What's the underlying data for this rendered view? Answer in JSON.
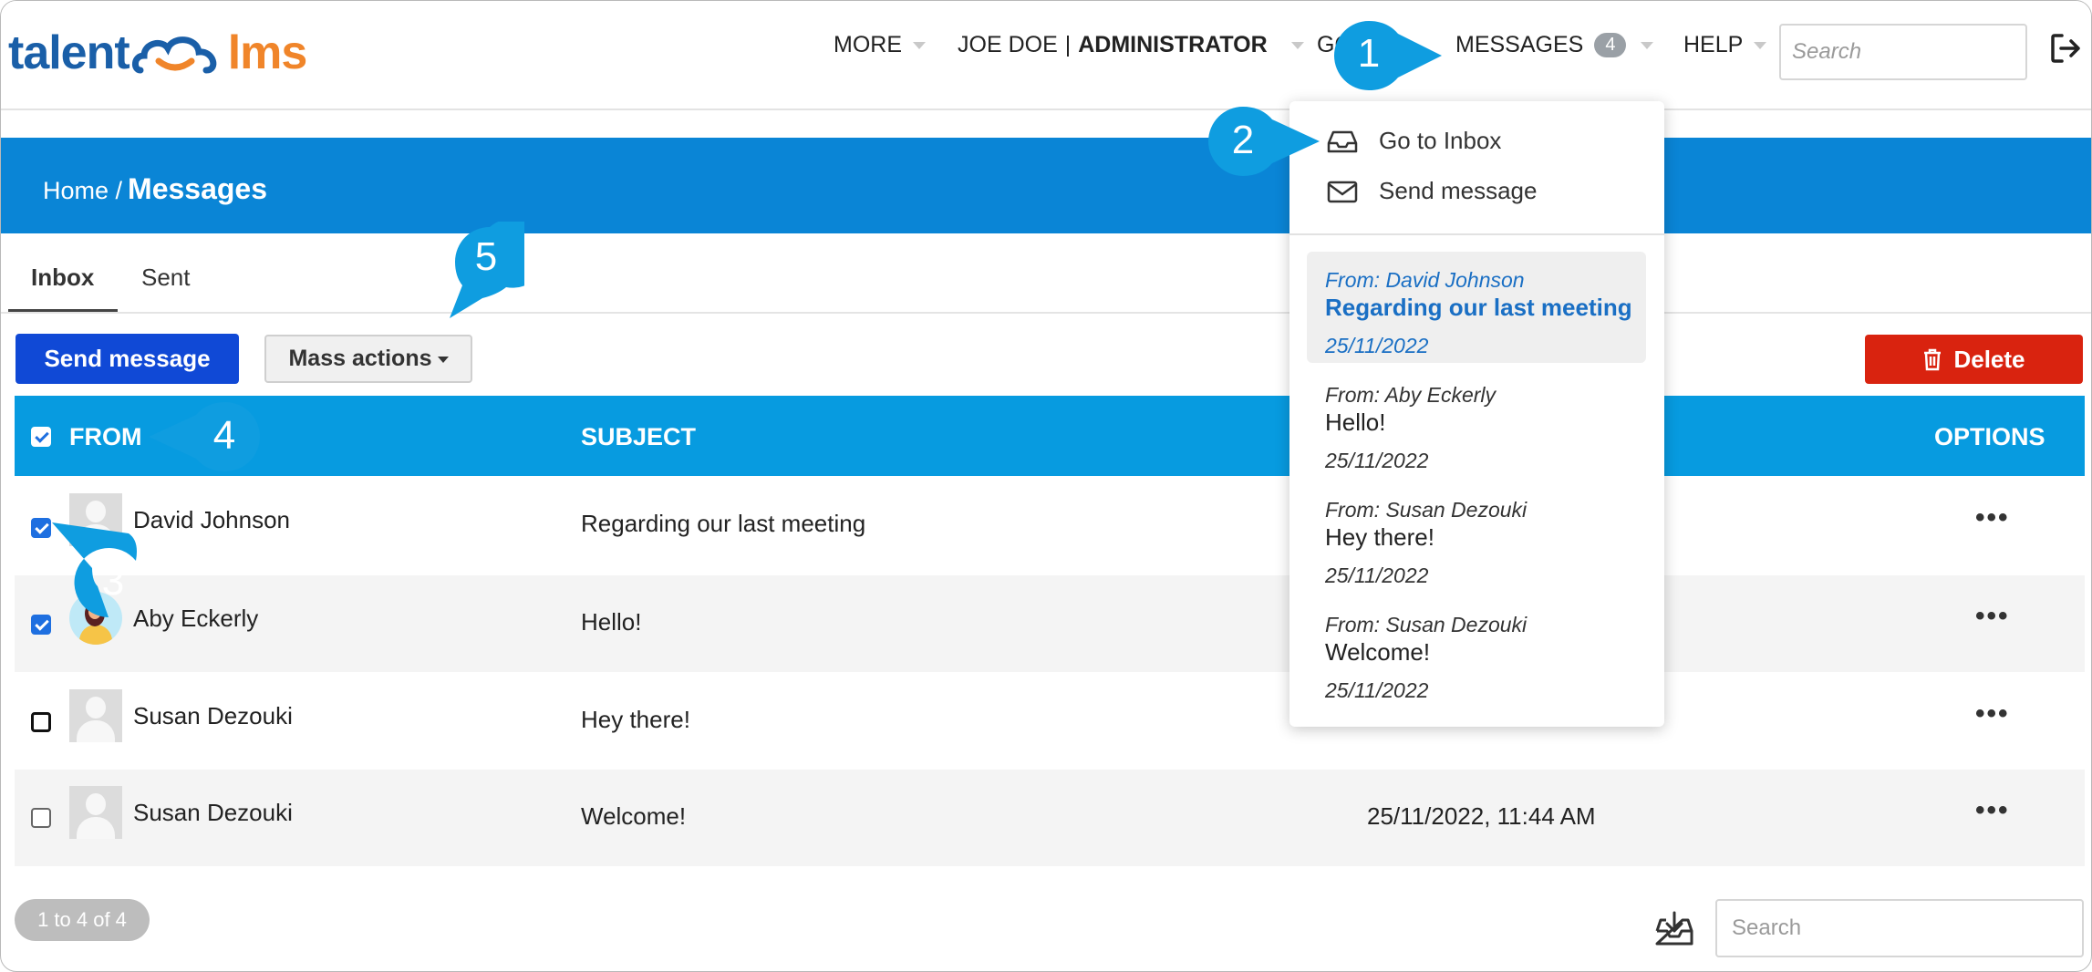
{
  "brand": {
    "logo_part1": "talent",
    "logo_part2": "lms"
  },
  "nav": {
    "more": "MORE",
    "user_name": "JOE DOE",
    "separator": "|",
    "role": "ADMINISTRATOR",
    "goto_partial": "GO",
    "messages": "MESSAGES",
    "messages_count": "4",
    "help": "HELP",
    "search_placeholder": "Search"
  },
  "breadcrumb": {
    "home": "Home /",
    "current": "Messages"
  },
  "tabs": [
    {
      "label": "Inbox",
      "active": true
    },
    {
      "label": "Sent",
      "active": false
    }
  ],
  "toolbar": {
    "send_label": "Send message",
    "mass_label": "Mass actions",
    "delete_label": "Delete"
  },
  "table": {
    "headers": {
      "from": "FROM",
      "subject": "SUBJECT",
      "options": "OPTIONS"
    },
    "rows": [
      {
        "from": "David Johnson",
        "subject": "Regarding our last meeting",
        "date": "",
        "checked": true
      },
      {
        "from": "Aby Eckerly",
        "subject": "Hello!",
        "date": "",
        "checked": true
      },
      {
        "from": "Susan Dezouki",
        "subject": "Hey there!",
        "date": "",
        "checked": false
      },
      {
        "from": "Susan Dezouki",
        "subject": "Welcome!",
        "date": "25/11/2022, 11:44 AM",
        "checked": false
      }
    ],
    "options_glyph": "•••"
  },
  "footer": {
    "count_label": "1 to 4 of 4",
    "search_placeholder": "Search"
  },
  "dropdown": {
    "goto_inbox": "Go to Inbox",
    "send_message": "Send message",
    "messages": [
      {
        "from": "From: David Johnson",
        "subject": "Regarding our last meeting",
        "date": "25/11/2022",
        "selected": true
      },
      {
        "from": "From: Aby Eckerly",
        "subject": "Hello!",
        "date": "25/11/2022",
        "selected": false
      },
      {
        "from": "From: Susan Dezouki",
        "subject": "Hey there!",
        "date": "25/11/2022",
        "selected": false
      },
      {
        "from": "From: Susan Dezouki",
        "subject": "Welcome!",
        "date": "25/11/2022",
        "selected": false
      }
    ]
  },
  "callouts": [
    "1",
    "2",
    "3",
    "4",
    "5"
  ],
  "colors": {
    "brand_blue": "#1a5fa8",
    "brand_orange": "#f0852a",
    "header_blue": "#0a85d6",
    "table_header": "#079be0",
    "send_button": "#1049d6",
    "delete_button": "#d9230f",
    "callout": "#0f9de0"
  },
  "icons": [
    "logo-cloud-icon",
    "logout-icon",
    "inbox-tray-icon",
    "envelope-icon",
    "trash-icon",
    "export-tray-icon",
    "caret-down-icon"
  ]
}
